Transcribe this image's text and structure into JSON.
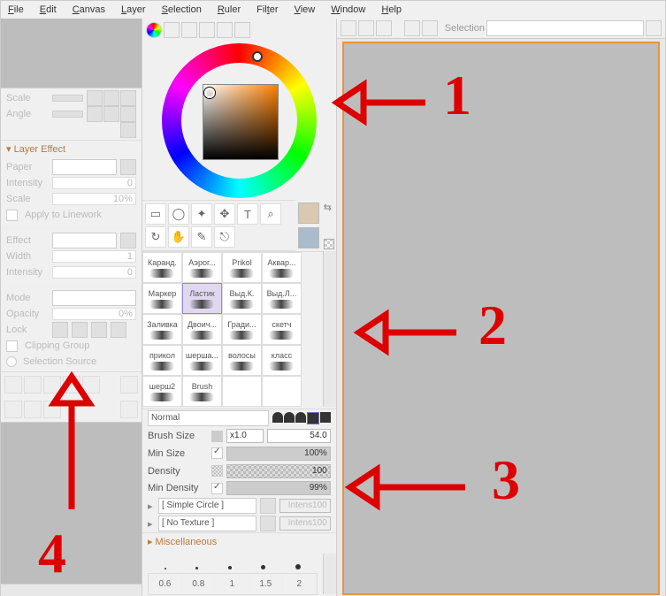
{
  "menu": [
    "File",
    "Edit",
    "Canvas",
    "Layer",
    "Selection",
    "Ruler",
    "Filter",
    "View",
    "Window",
    "Help"
  ],
  "left": {
    "scale_label": "Scale",
    "angle_label": "Angle",
    "layer_effect": "Layer Effect",
    "paper": "Paper",
    "intensity": "Intensity",
    "intensity_val": "0",
    "scale2": "Scale",
    "scale2_val": "10%",
    "apply_linework": "Apply to Linework",
    "effect": "Effect",
    "width": "Width",
    "width_val": "1",
    "intensity2": "Intensity",
    "intensity2_val": "0",
    "mode": "Mode",
    "opacity": "Opacity",
    "opacity_val": "0%",
    "lock": "Lock",
    "clipping": "Clipping Group",
    "selsrc": "Selection Source"
  },
  "mid": {
    "brushes": [
      [
        "Каранд.",
        "Аэрог...",
        "Prikol",
        "Аквар..."
      ],
      [
        "Маркер",
        "Ластик",
        "Выд.К.",
        "Выд.Л..."
      ],
      [
        "Заливка",
        "Двоич...",
        "Гради...",
        "скетч"
      ],
      [
        "прикол",
        "шерша...",
        "волосы",
        "класс"
      ],
      [
        "шерш2",
        "Brush",
        "",
        ""
      ]
    ],
    "selected_brush": "Ластик",
    "blend": "Normal",
    "brush_size_lbl": "Brush Size",
    "brush_size_mult": "x1.0",
    "brush_size": "54.0",
    "min_size_lbl": "Min Size",
    "min_size": "100%",
    "density_lbl": "Density",
    "density": "100",
    "min_density_lbl": "Min Density",
    "min_density": "99%",
    "shape_lbl": "[ Simple Circle ]",
    "shape_int": "100",
    "texture_lbl": "[ No Texture ]",
    "texture_int": "100",
    "intens_btn": "Intens",
    "misc": "Miscellaneous",
    "tips": [
      "0.6",
      "0.8",
      "1",
      "1.5",
      "2"
    ]
  },
  "right": {
    "selection_lbl": "Selection"
  },
  "anno": {
    "n1": "1",
    "n2": "2",
    "n3": "3",
    "n4": "4"
  }
}
